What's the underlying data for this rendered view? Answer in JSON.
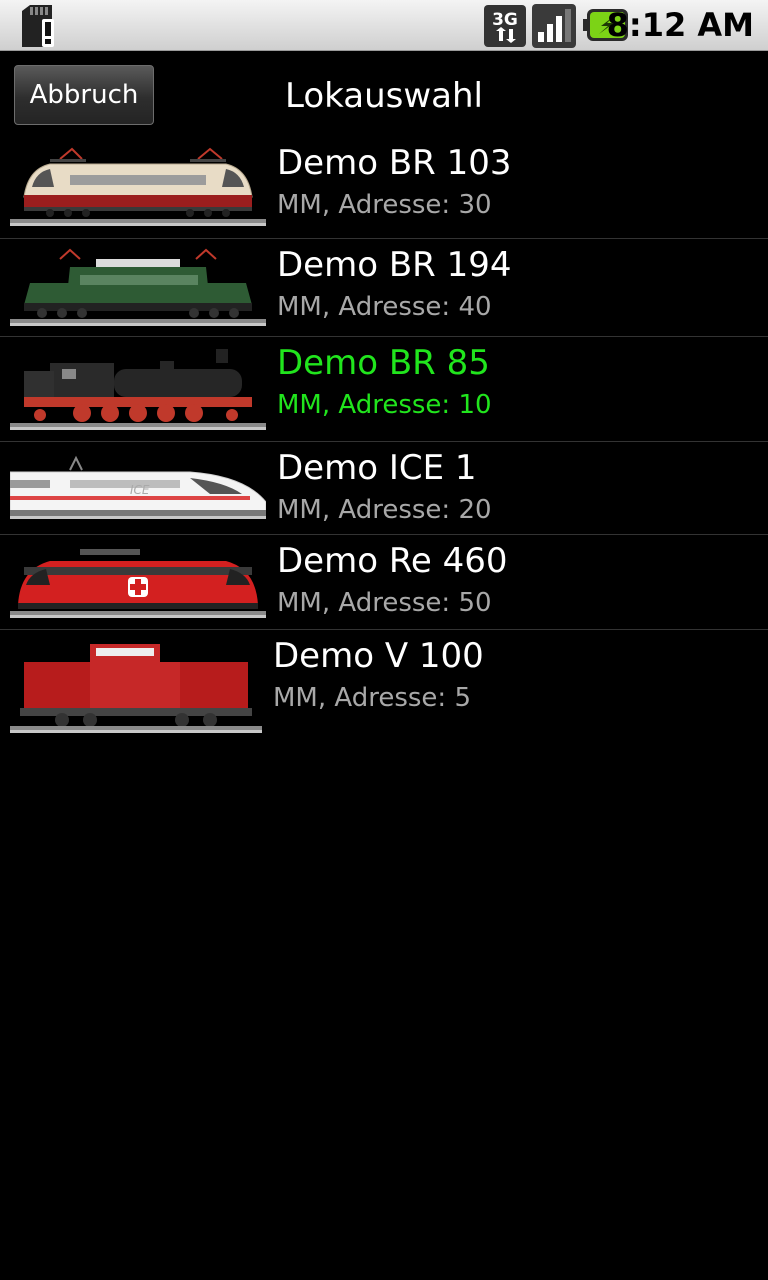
{
  "status_bar": {
    "time": "8:12 AM",
    "network_label": "3G",
    "icons": [
      "sd-card-alert-icon",
      "network-3g-icon",
      "signal-icon",
      "battery-charging-icon"
    ]
  },
  "header": {
    "cancel_label": "Abbruch",
    "title": "Lokauswahl"
  },
  "locos": [
    {
      "name": "Demo BR 103",
      "detail": "MM, Adresse: 30",
      "selected": false,
      "image": "br103-locomotive"
    },
    {
      "name": "Demo BR 194",
      "detail": "MM, Adresse: 40",
      "selected": false,
      "image": "br194-locomotive"
    },
    {
      "name": "Demo BR 85",
      "detail": "MM, Adresse: 10",
      "selected": true,
      "image": "br85-steam-locomotive"
    },
    {
      "name": "Demo ICE 1",
      "detail": "MM, Adresse: 20",
      "selected": false,
      "image": "ice1-locomotive"
    },
    {
      "name": "Demo Re 460",
      "detail": "MM, Adresse: 50",
      "selected": false,
      "image": "re460-locomotive"
    },
    {
      "name": "Demo V 100",
      "detail": "MM, Adresse: 5",
      "selected": false,
      "image": "v100-locomotive"
    }
  ],
  "colors": {
    "selected_text": "#21e51d",
    "secondary_text": "#a8a8a8",
    "background": "#000000"
  }
}
